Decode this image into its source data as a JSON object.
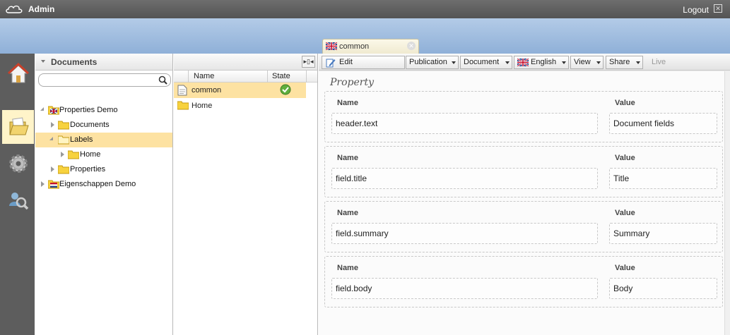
{
  "topbar": {
    "app_name": "Admin",
    "logout_label": "Logout",
    "logo_icon": "cloud-logo-icon"
  },
  "document_tab": {
    "label": "common",
    "flag_icon": "uk-flag-icon"
  },
  "rail": [
    {
      "name": "home-icon",
      "active": false
    },
    {
      "name": "documents-icon",
      "active": true
    },
    {
      "name": "settings-icon",
      "active": false
    },
    {
      "name": "users-search-icon",
      "active": false
    }
  ],
  "documents_panel": {
    "title": "Documents",
    "search_value": "",
    "tree": [
      {
        "label": "Properties Demo",
        "level": 0,
        "expanded": true,
        "icon": "uk-flag-folder-icon",
        "selected": false
      },
      {
        "label": "Documents",
        "level": 1,
        "expanded": false,
        "icon": "folder-icon",
        "selected": false
      },
      {
        "label": "Labels",
        "level": 1,
        "expanded": true,
        "icon": "folder-icon",
        "selected": true
      },
      {
        "label": "Home",
        "level": 2,
        "expanded": false,
        "icon": "folder-icon",
        "selected": false
      },
      {
        "label": "Properties",
        "level": 1,
        "expanded": false,
        "icon": "folder-icon",
        "selected": false
      },
      {
        "label": "Eigenschappen Demo",
        "level": 0,
        "expanded": false,
        "icon": "nl-flag-folder-icon",
        "selected": false
      }
    ]
  },
  "file_list": {
    "columns": {
      "name": "Name",
      "state": "State"
    },
    "rows": [
      {
        "name": "common",
        "icon": "document-icon",
        "state": "published-check-icon",
        "selected": true
      },
      {
        "name": "Home",
        "icon": "folder-icon",
        "state": "",
        "selected": false
      }
    ]
  },
  "toolbar": {
    "edit_label": "Edit",
    "publication_label": "Publication",
    "document_label": "Document",
    "language_label": "English",
    "view_label": "View",
    "share_label": "Share",
    "live_label": "Live"
  },
  "editor": {
    "section_title": "Property",
    "name_header": "Name",
    "value_header": "Value",
    "properties": [
      {
        "name": "header.text",
        "value": "Document fields"
      },
      {
        "name": "field.title",
        "value": "Title"
      },
      {
        "name": "field.summary",
        "value": "Summary"
      },
      {
        "name": "field.body",
        "value": "Body"
      }
    ]
  },
  "colors": {
    "accent_selected": "#fde2a2",
    "topbar": "#5e5e5e",
    "band": "#a3bfe2"
  }
}
